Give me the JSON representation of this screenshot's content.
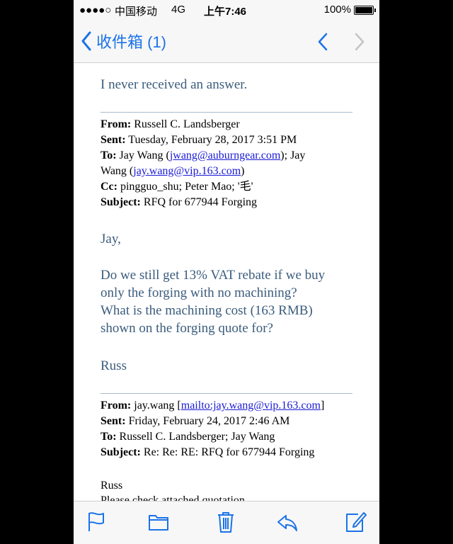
{
  "status_bar": {
    "signal": "●●●●○",
    "carrier": "中国移动",
    "network": "4G",
    "time": "上午7:46",
    "battery": "100%"
  },
  "nav": {
    "back_label": "收件箱 (1)",
    "up_icon": "chevron-up-icon",
    "down_icon": "chevron-down-icon"
  },
  "body": {
    "intro": "I never received an answer.",
    "header1": {
      "from_label": "From:",
      "from": "Russell C. Landsberger",
      "sent_label": "Sent:",
      "sent": "Tuesday, February 28, 2017 3:51 PM",
      "to_label": "To:",
      "to_name1": "Jay Wang (",
      "to_email1": "jwang@auburngear.com",
      "to_sep": "); Jay",
      "to_name2": "Wang (",
      "to_email2": "jay.wang@vip.163.com",
      "to_end": ")",
      "cc_label": "Cc:",
      "cc": "pingguo_shu; Peter Mao; '毛'",
      "subject_label": "Subject:",
      "subject": "RFQ for 677944 Forging"
    },
    "greeting": "Jay,",
    "message_line1": "Do we still get 13% VAT rebate if we buy",
    "message_line2": "only the forging with no machining?",
    "message_line3": "What is the machining cost (163 RMB)",
    "message_line4": "shown on the forging quote for?",
    "signature": "Russ",
    "header2": {
      "from_label": "From:",
      "from": "jay.wang [",
      "from_link": "mailto:jay.wang@vip.163.com",
      "from_end": "]",
      "sent_label": "Sent:",
      "sent": "Friday, February 24, 2017 2:46 AM",
      "to_label": "To:",
      "to": "Russell C. Landsberger; Jay Wang",
      "subject_label": "Subject:",
      "subject": "Re: Re: RE: RFQ for 677944 Forging"
    },
    "reply_greeting": "Russ",
    "reply_line1": "Please check attached quotation"
  },
  "toolbar": {
    "icons": [
      "flag-icon",
      "folder-icon",
      "trash-icon",
      "reply-icon",
      "compose-icon"
    ]
  },
  "colors": {
    "accent": "#1a73e8",
    "body_text": "#3b5c7d",
    "link": "#1a1ad6"
  }
}
